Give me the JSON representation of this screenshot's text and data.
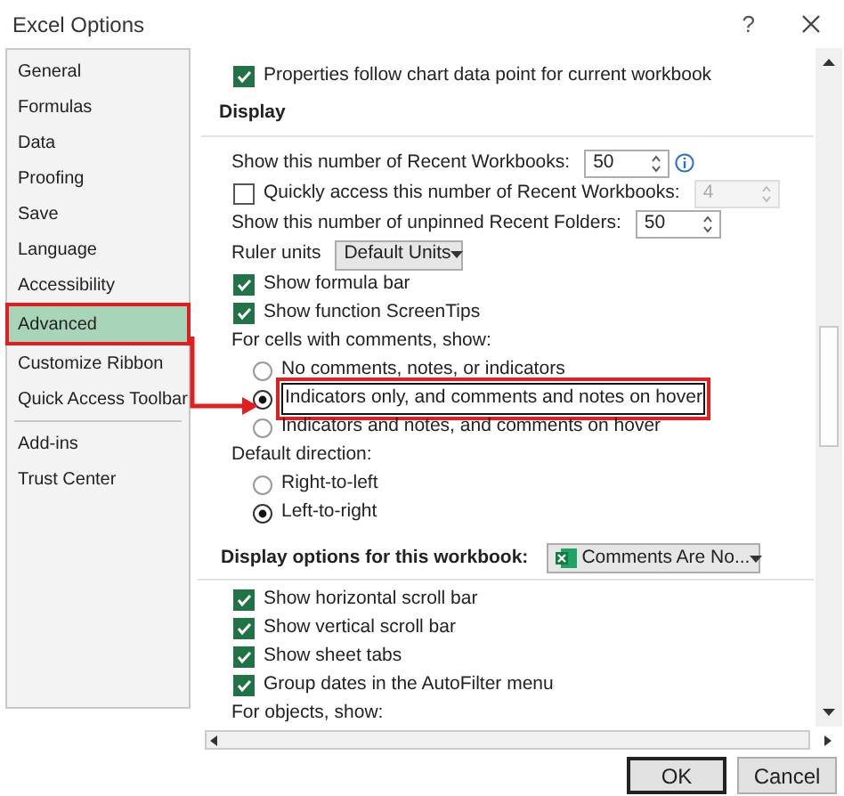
{
  "window": {
    "title": "Excel Options",
    "help": "?"
  },
  "sidebar": {
    "groups": [
      [
        {
          "label": "General",
          "selected": false,
          "highlighted": false
        },
        {
          "label": "Formulas",
          "selected": false,
          "highlighted": false
        },
        {
          "label": "Data",
          "selected": false,
          "highlighted": false
        },
        {
          "label": "Proofing",
          "selected": false,
          "highlighted": false
        },
        {
          "label": "Save",
          "selected": false,
          "highlighted": false
        },
        {
          "label": "Language",
          "selected": false,
          "highlighted": false
        },
        {
          "label": "Accessibility",
          "selected": false,
          "highlighted": false
        },
        {
          "label": "Advanced",
          "selected": true,
          "highlighted": true
        },
        {
          "label": "Customize Ribbon",
          "selected": false,
          "highlighted": false
        },
        {
          "label": "Quick Access Toolbar",
          "selected": false,
          "highlighted": false
        }
      ],
      [
        {
          "label": "Add-ins",
          "selected": false,
          "highlighted": false
        },
        {
          "label": "Trust Center",
          "selected": false,
          "highlighted": false
        }
      ]
    ]
  },
  "options": [
    {
      "kind": "checkbox",
      "label": "Properties follow chart data point for current workbook",
      "checked": true
    },
    {
      "kind": "heading",
      "label": "Display"
    },
    {
      "kind": "spinner",
      "label": "Show this number of Recent Workbooks:",
      "value": "50",
      "info": true,
      "disabled": false
    },
    {
      "kind": "checkbox_spinner",
      "label": "Quickly access this number of Recent Workbooks:",
      "checked": false,
      "value": "4",
      "disabled": true
    },
    {
      "kind": "spinner",
      "label": "Show this number of unpinned Recent Folders:",
      "value": "50",
      "info": false,
      "disabled": false
    },
    {
      "kind": "dropdown",
      "label": "Ruler units",
      "value": "Default Units"
    },
    {
      "kind": "checkbox",
      "label": "Show formula bar",
      "checked": true
    },
    {
      "kind": "checkbox",
      "label": "Show function ScreenTips",
      "checked": true
    },
    {
      "kind": "label",
      "label": "For cells with comments, show:"
    },
    {
      "kind": "radio",
      "label": "No comments, notes, or indicators",
      "selected": false,
      "highlighted": false
    },
    {
      "kind": "radio",
      "label": "Indicators only, and comments and notes on hover",
      "selected": true,
      "highlighted": true
    },
    {
      "kind": "radio",
      "label": "Indicators and notes, and comments on hover",
      "selected": false,
      "highlighted": false
    },
    {
      "kind": "label",
      "label": "Default direction:"
    },
    {
      "kind": "radio",
      "label": "Right-to-left",
      "selected": false,
      "highlighted": false
    },
    {
      "kind": "radio",
      "label": "Left-to-right",
      "selected": true,
      "highlighted": false
    },
    {
      "kind": "section_dropdown",
      "label": "Display options for this workbook:",
      "value": "Comments Are No..."
    },
    {
      "kind": "checkbox",
      "label": "Show horizontal scroll bar",
      "checked": true
    },
    {
      "kind": "checkbox",
      "label": "Show vertical scroll bar",
      "checked": true
    },
    {
      "kind": "checkbox",
      "label": "Show sheet tabs",
      "checked": true
    },
    {
      "kind": "checkbox",
      "label": "Group dates in the AutoFilter menu",
      "checked": true
    },
    {
      "kind": "label",
      "label": "For objects, show:"
    }
  ],
  "buttons": [
    "OK",
    "Cancel"
  ]
}
